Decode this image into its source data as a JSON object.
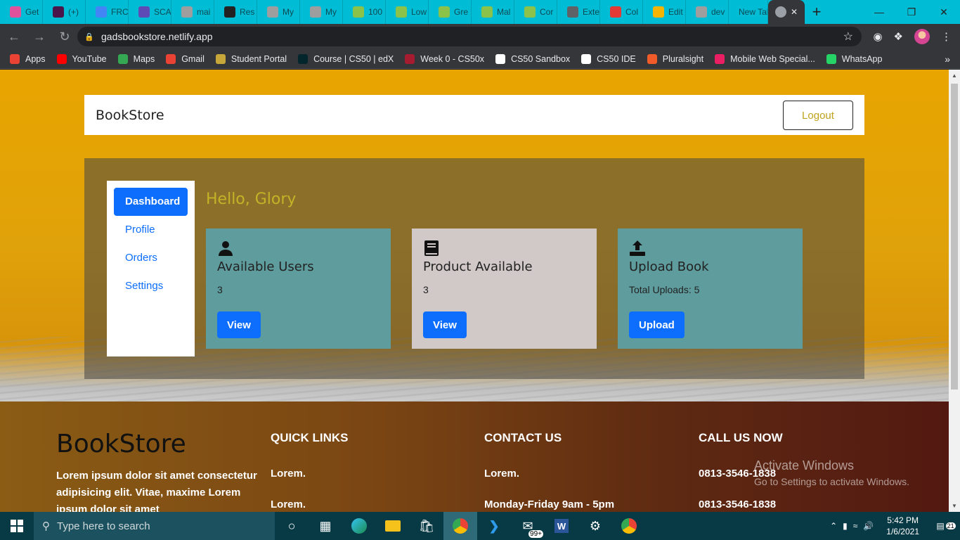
{
  "browser": {
    "tabs": [
      {
        "label": "Get",
        "color": "#e0529c"
      },
      {
        "label": "(+)",
        "color": "#4a154b"
      },
      {
        "label": "FRC",
        "color": "#4285f4"
      },
      {
        "label": "SCA",
        "color": "#5f4bb6"
      },
      {
        "label": "mai",
        "color": "#9e9e9e"
      },
      {
        "label": "Res",
        "color": "#222222"
      },
      {
        "label": "My",
        "color": "#9e9e9e"
      },
      {
        "label": "My",
        "color": "#9e9e9e"
      },
      {
        "label": "100",
        "color": "#8bc34a"
      },
      {
        "label": "Low",
        "color": "#8bc34a"
      },
      {
        "label": "Gre",
        "color": "#8bc34a"
      },
      {
        "label": "Mal",
        "color": "#8bc34a"
      },
      {
        "label": "Cor",
        "color": "#8bc34a"
      },
      {
        "label": "Exte",
        "color": "#5f6368"
      },
      {
        "label": "Col",
        "color": "#e53935"
      },
      {
        "label": "Edit",
        "color": "#f4b400"
      },
      {
        "label": "dev",
        "color": "#9e9e9e"
      },
      {
        "label": "New Tab",
        "color": ""
      }
    ],
    "active_tab_close": "✕",
    "new_tab": "+",
    "url": "gadsbookstore.netlify.app",
    "bookmarks": [
      {
        "label": "Apps",
        "color": "#ea4335"
      },
      {
        "label": "YouTube",
        "color": "#ff0000"
      },
      {
        "label": "Maps",
        "color": "#34a853"
      },
      {
        "label": "Gmail",
        "color": "#ea4335"
      },
      {
        "label": "Student Portal",
        "color": "#c8a73a"
      },
      {
        "label": "Course | CS50 | edX",
        "color": "#02262b"
      },
      {
        "label": "Week 0 - CS50x",
        "color": "#a51c30"
      },
      {
        "label": "CS50 Sandbox",
        "color": "#ffffff"
      },
      {
        "label": "CS50 IDE",
        "color": "#ffffff"
      },
      {
        "label": "Pluralsight",
        "color": "#f15b2a"
      },
      {
        "label": "Mobile Web Special...",
        "color": "#e91e63"
      },
      {
        "label": "WhatsApp",
        "color": "#25d366"
      }
    ],
    "bookmarks_more": "»"
  },
  "navbar": {
    "brand": "BookStore",
    "logout": "Logout"
  },
  "sidebar": {
    "items": [
      {
        "label": "Dashboard",
        "active": true
      },
      {
        "label": "Profile",
        "active": false
      },
      {
        "label": "Orders",
        "active": false
      },
      {
        "label": "Settings",
        "active": false
      }
    ]
  },
  "greeting": "Hello, Glory",
  "cards": [
    {
      "title": "Available Users",
      "value": "3",
      "button": "View",
      "icon": "user-icon",
      "bg": "#5f9c9e"
    },
    {
      "title": "Product Available",
      "value": "3",
      "button": "View",
      "icon": "book-icon",
      "bg": "#d1c8c8"
    },
    {
      "title": "Upload Book",
      "value": "Total Uploads: 5",
      "button": "Upload",
      "icon": "upload-icon",
      "bg": "#5f9c9e"
    }
  ],
  "footer": {
    "brand": "BookStore",
    "text": "Lorem ipsum dolor sit amet consectetur adipisicing elit. Vitae, maxime Lorem ipsum dolor sit amet",
    "quick_links": {
      "title": "QUICK LINKS",
      "items": [
        "Lorem.",
        "Lorem."
      ]
    },
    "contact": {
      "title": "CONTACT US",
      "items": [
        "Lorem.",
        "Monday-Friday 9am - 5pm"
      ]
    },
    "call": {
      "title": "CALL US NOW",
      "items": [
        "0813-3546-1838",
        "0813-3546-1838"
      ]
    }
  },
  "watermark": {
    "title": "Activate Windows",
    "subtitle": "Go to Settings to activate Windows."
  },
  "taskbar": {
    "search_placeholder": "Type here to search",
    "time": "5:42 PM",
    "date": "1/6/2021",
    "mail_badge": "99+",
    "notifications": "21"
  }
}
